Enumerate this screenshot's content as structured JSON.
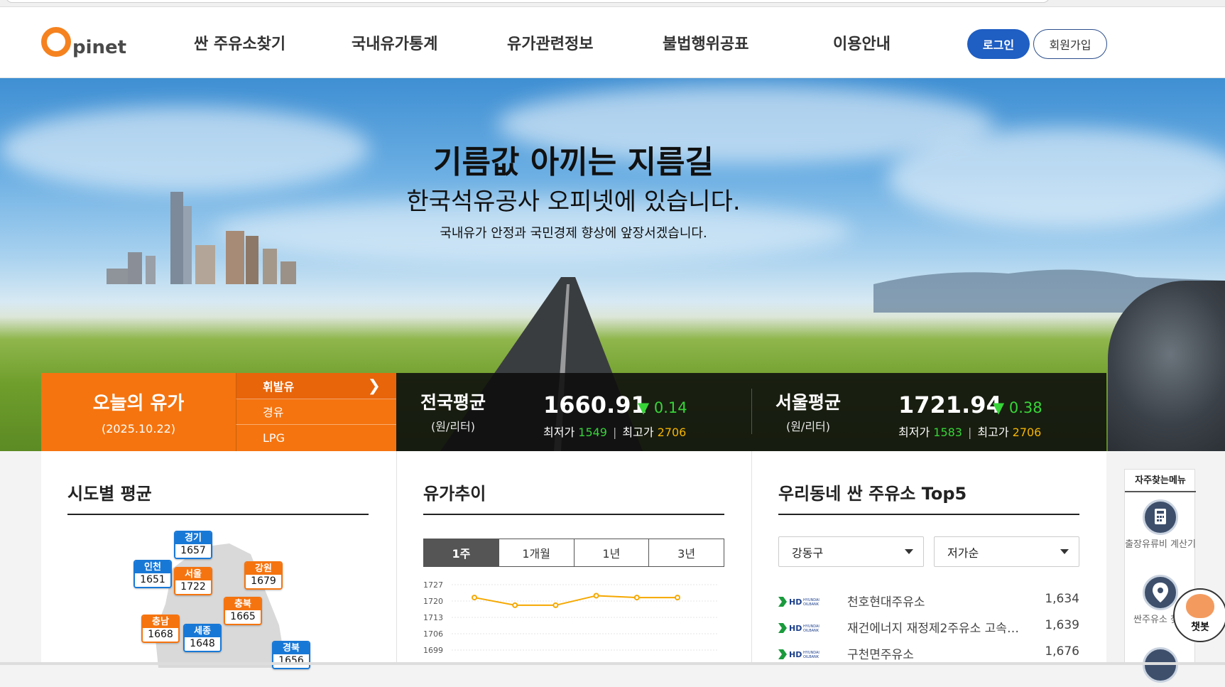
{
  "header": {
    "logo_text": "pinet",
    "nav": [
      "싼 주유소찾기",
      "국내유가통계",
      "유가관련정보",
      "불법행위공표",
      "이용안내"
    ],
    "login": "로그인",
    "join": "회원가입"
  },
  "hero": {
    "title": "기름값 아끼는 지름길",
    "subtitle": "한국석유공사 오피넷에 있습니다.",
    "tagline": "국내유가 안정과 국민경제 향상에 앞장서겠습니다."
  },
  "today": {
    "title": "오늘의 유가",
    "date": "(2025.10.22)",
    "fuels": [
      "휘발유",
      "경유",
      "LPG"
    ],
    "active_fuel": "휘발유"
  },
  "averages": [
    {
      "name": "전국평균",
      "unit": "(원/리터)",
      "value": "1660.91",
      "change": "0.14",
      "min_label": "최저가",
      "min": "1549",
      "max_label": "최고가",
      "max": "2706"
    },
    {
      "name": "서울평균",
      "unit": "(원/리터)",
      "value": "1721.94",
      "change": "0.38",
      "min_label": "최저가",
      "min": "1583",
      "max_label": "최고가",
      "max": "2706"
    }
  ],
  "panels": {
    "region": "시도별 평균",
    "trend": "유가추이",
    "top5": "우리동네 싼 주유소 Top5"
  },
  "regions": [
    {
      "name": "경기",
      "value": "1657",
      "color": "blue"
    },
    {
      "name": "인천",
      "value": "1651",
      "color": "blue"
    },
    {
      "name": "서울",
      "value": "1722",
      "color": "orange"
    },
    {
      "name": "강원",
      "value": "1679",
      "color": "orange"
    },
    {
      "name": "충북",
      "value": "1665",
      "color": "orange"
    },
    {
      "name": "충남",
      "value": "1668",
      "color": "orange"
    },
    {
      "name": "세종",
      "value": "1648",
      "color": "blue"
    },
    {
      "name": "경북",
      "value": "1656",
      "color": "blue"
    }
  ],
  "trend": {
    "tabs": [
      "1주",
      "1개월",
      "1년",
      "3년"
    ],
    "active": "1주"
  },
  "chart_data": {
    "type": "line",
    "title": "",
    "xlabel": "",
    "ylabel": "",
    "y_ticks": [
      "1727",
      "1720",
      "1713",
      "1706",
      "1699"
    ],
    "ylim": [
      1699,
      1727
    ],
    "values": [
      1721.5,
      1718.2,
      1718.2,
      1722.3,
      1721.5,
      1721.5
    ],
    "color": "#f5a800",
    "grid": true
  },
  "top5": {
    "district": "강동구",
    "sort": "저가순",
    "stations": [
      {
        "brand": "HD HYUNDAI OILBANK",
        "name": "천호현대주유소",
        "price": "1,634"
      },
      {
        "brand": "HD HYUNDAI OILBANK",
        "name": "재건에너지 재정제2주유소 고속…",
        "price": "1,639"
      },
      {
        "brand": "HD HYUNDAI OILBANK",
        "name": "구천면주유소",
        "price": "1,676"
      }
    ]
  },
  "quick_menu": {
    "title": "자주찾는메뉴",
    "items": [
      "출장유류비 계산기",
      "싼주유소 찾기"
    ]
  },
  "chatbot": "챗봇",
  "colors": {
    "accent": "#f5740f",
    "primary": "#1f5ec2",
    "down": "#37d438",
    "max": "#f5b400"
  }
}
